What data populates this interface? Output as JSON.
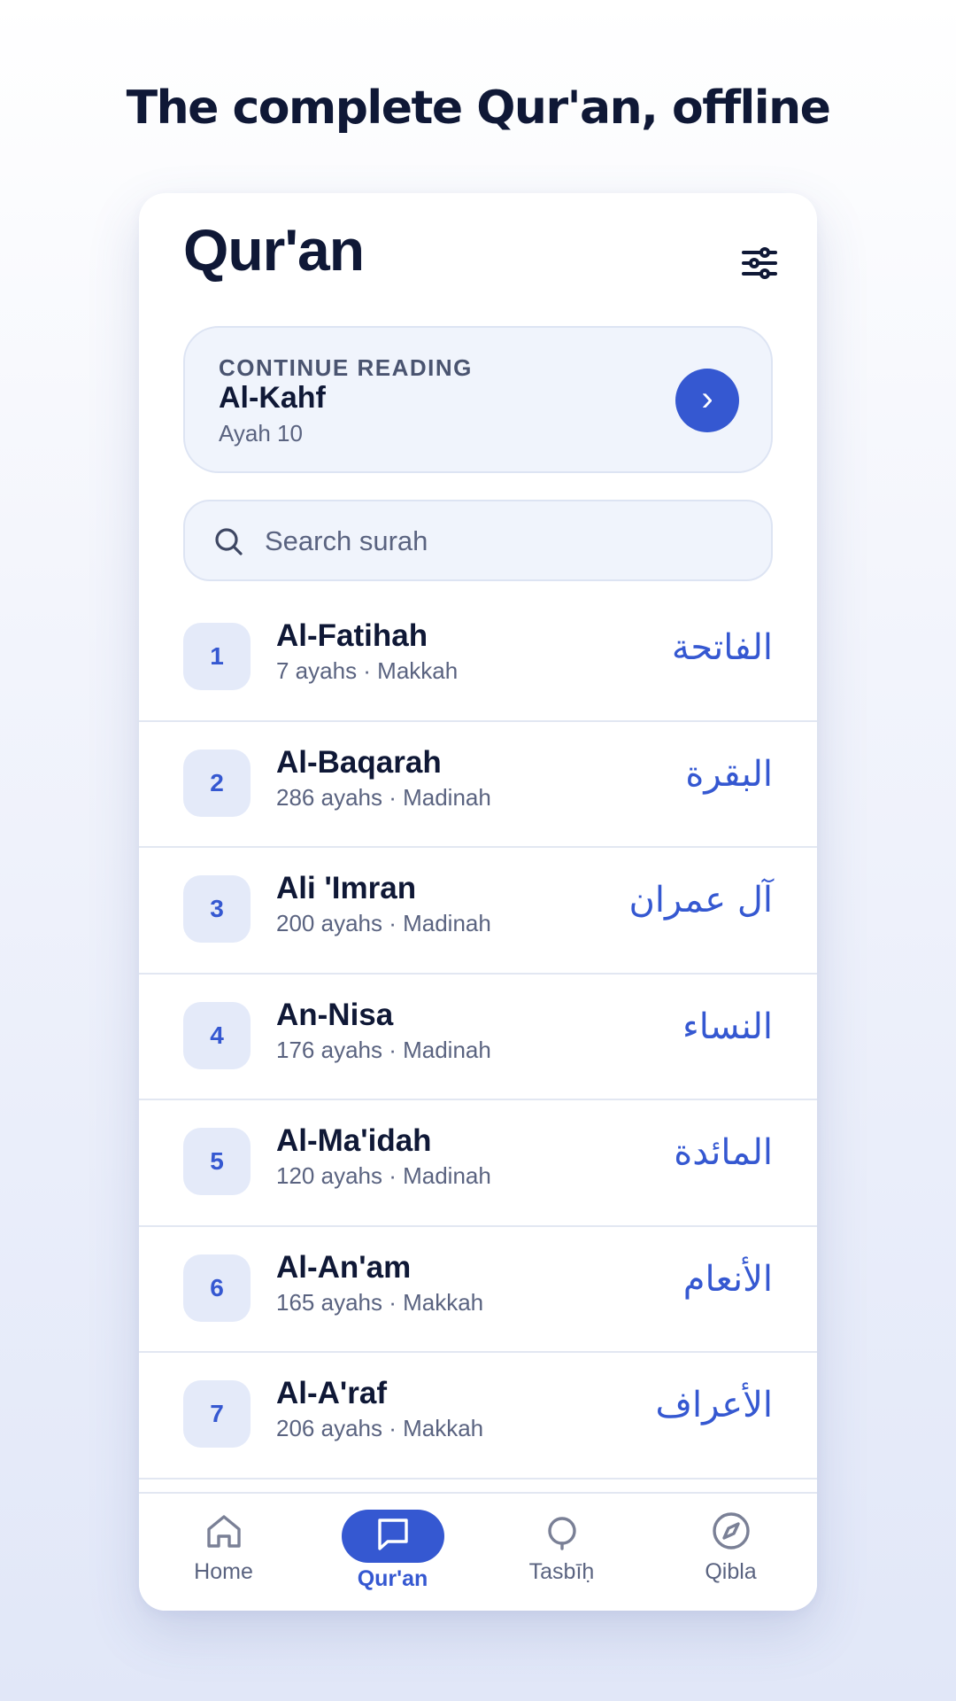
{
  "headline": "The complete Qur'an, offline",
  "header": {
    "title": "Qur'an",
    "filter_icon": "sliders-icon"
  },
  "continue_reading": {
    "label": "CONTINUE READING",
    "surah": "Al-Kahf",
    "ayah": "Ayah 10",
    "button_icon": "chevron-right-icon",
    "button_glyph": "›"
  },
  "search": {
    "placeholder": "Search surah",
    "value": ""
  },
  "surahs": [
    {
      "number": "1",
      "name": "Al-Fatihah",
      "meta": "7 ayahs · Makkah",
      "arabic": "الفاتحة"
    },
    {
      "number": "2",
      "name": "Al-Baqarah",
      "meta": "286 ayahs · Madinah",
      "arabic": "البقرة"
    },
    {
      "number": "3",
      "name": "Ali 'Imran",
      "meta": "200 ayahs · Madinah",
      "arabic": "آل عمران"
    },
    {
      "number": "4",
      "name": "An-Nisa",
      "meta": "176 ayahs · Madinah",
      "arabic": "النساء"
    },
    {
      "number": "5",
      "name": "Al-Ma'idah",
      "meta": "120 ayahs · Madinah",
      "arabic": "المائدة"
    },
    {
      "number": "6",
      "name": "Al-An'am",
      "meta": "165 ayahs · Makkah",
      "arabic": "الأنعام"
    },
    {
      "number": "7",
      "name": "Al-A'raf",
      "meta": "206 ayahs · Makkah",
      "arabic": "الأعراف"
    }
  ],
  "tabs": [
    {
      "label": "Home",
      "icon": "home-icon",
      "active": false
    },
    {
      "label": "Qur'an",
      "icon": "book-icon",
      "active": true
    },
    {
      "label": "Tasbīḥ",
      "icon": "prayer-beads-icon",
      "active": false
    },
    {
      "label": "Qibla",
      "icon": "compass-icon",
      "active": false
    }
  ],
  "colors": {
    "accent": "#3558d1",
    "text_primary": "#0f1836",
    "text_secondary": "#5a6380",
    "card_bg": "#f0f4fc",
    "number_badge_bg": "#e4eaf9"
  }
}
